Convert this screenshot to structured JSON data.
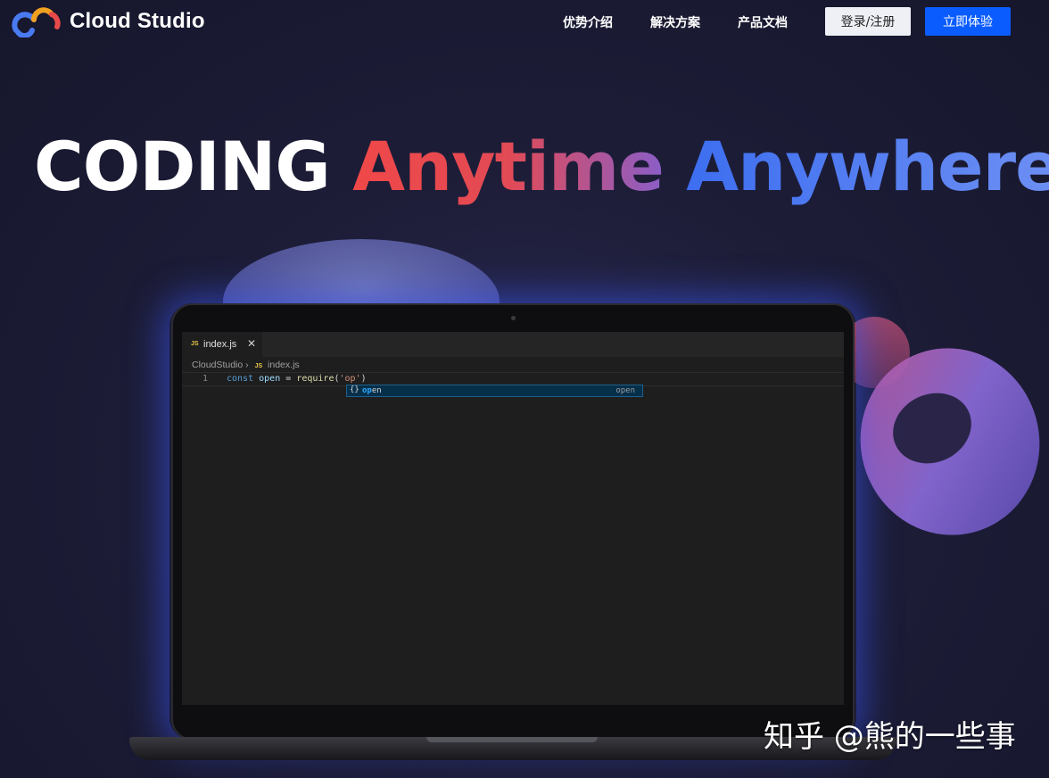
{
  "header": {
    "brand": "Cloud Studio",
    "nav": [
      "优势介绍",
      "解决方案",
      "产品文档"
    ],
    "login_label": "登录/注册",
    "try_label": "立即体验"
  },
  "hero": {
    "word1": "CODING",
    "word2": "Anytime",
    "word3": "Anywhere"
  },
  "editor": {
    "tab_icon": "JS",
    "tab_name": "index.js",
    "tab_close": "✕",
    "breadcrumb_root": "CloudStudio",
    "breadcrumb_sep": "›",
    "breadcrumb_icon": "JS",
    "breadcrumb_file": "index.js",
    "line_number": "1",
    "code": {
      "kw": "const",
      "var": "open",
      "eq": "=",
      "fn": "require",
      "arg": "'op'"
    },
    "suggestion": {
      "icon": "{}",
      "match": "op",
      "rest": "en",
      "detail": "open"
    }
  },
  "watermark": "知乎 @熊的一些事",
  "colors": {
    "accent": "#0b5cff",
    "anytime_start": "#f04848",
    "anywhere": "#4a7af0"
  }
}
